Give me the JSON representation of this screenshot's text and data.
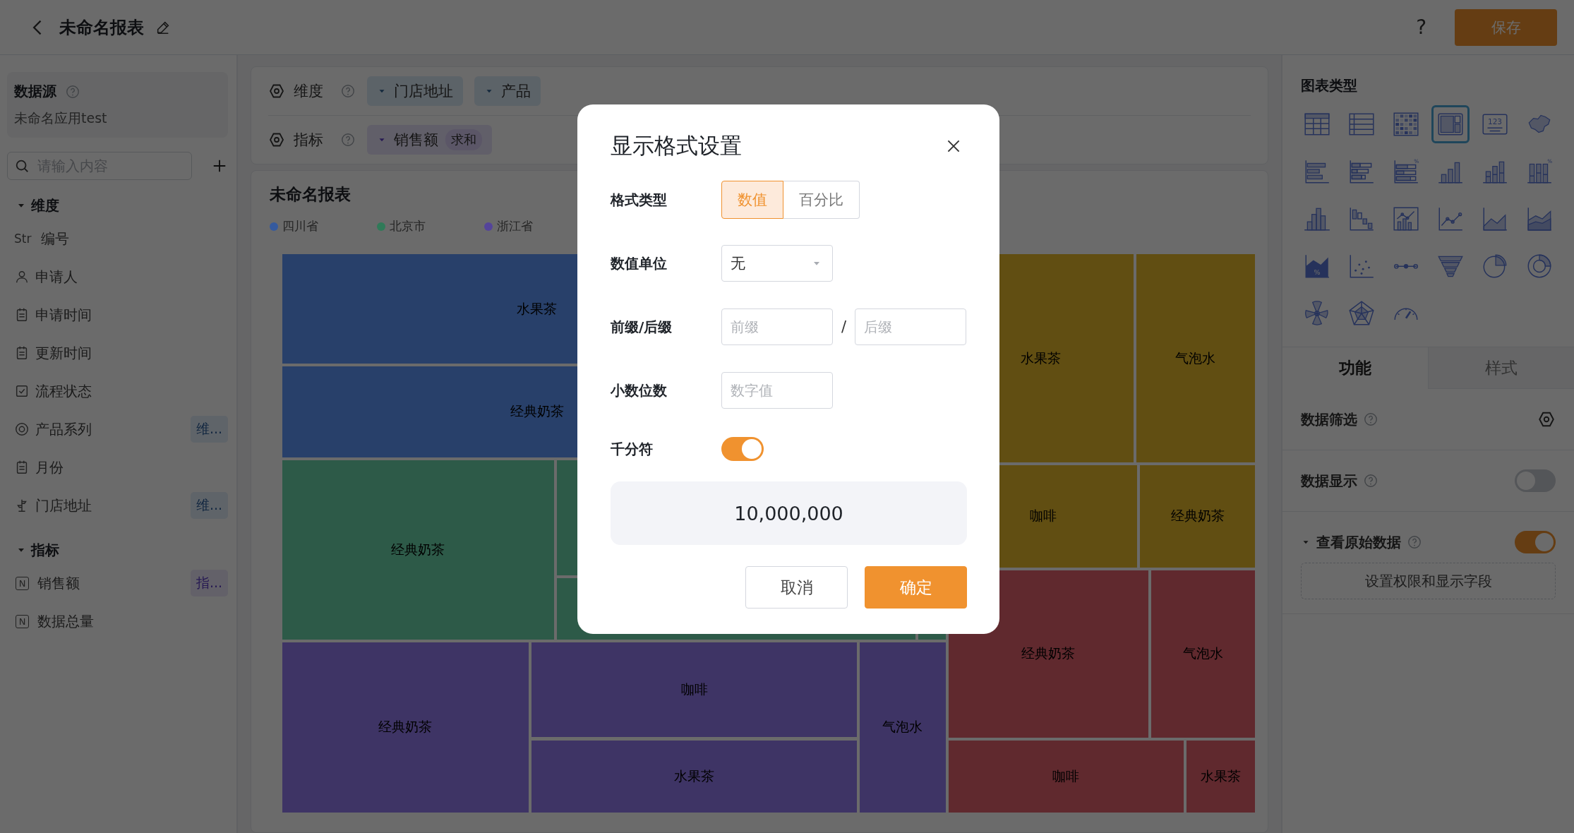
{
  "header": {
    "title": "未命名报表",
    "help": "?",
    "save_button": "保存"
  },
  "sidebar": {
    "datasource": {
      "label": "数据源",
      "value": "未命名应用test"
    },
    "search": {
      "placeholder": "请输入内容"
    },
    "groups": [
      {
        "label": "维度",
        "kind": "dimension",
        "expanded": true,
        "children": [
          {
            "kind": "str",
            "type_label": "Str",
            "label": "编号"
          },
          {
            "kind": "user",
            "label": "申请人"
          },
          {
            "kind": "date",
            "label": "申请时间"
          },
          {
            "kind": "date",
            "label": "更新时间"
          },
          {
            "kind": "check",
            "label": "流程状态"
          },
          {
            "kind": "target",
            "label": "产品系列",
            "badge": "维..."
          },
          {
            "kind": "date",
            "label": "月份"
          },
          {
            "kind": "geo",
            "label": "门店地址",
            "badge": "维..."
          }
        ]
      },
      {
        "label": "指标",
        "kind": "measure",
        "expanded": true,
        "children": [
          {
            "kind": "number",
            "type_label": "N",
            "label": "销售额",
            "badge": "指..."
          },
          {
            "kind": "number",
            "type_label": "N",
            "label": "数据总量"
          }
        ]
      }
    ]
  },
  "config": {
    "rows": [
      {
        "label": "维度",
        "kind": "dimension",
        "fields": [
          {
            "label": "门店地址"
          },
          {
            "label": "产品"
          }
        ]
      },
      {
        "label": "指标",
        "kind": "measure",
        "fields": [
          {
            "label": "销售额",
            "aggregate": "求和"
          }
        ]
      }
    ]
  },
  "chart": {
    "title": "未命名报表",
    "legend": [
      {
        "label": "四川省",
        "color": "#355a9e"
      },
      {
        "label": "北京市",
        "color": "#2f7a58"
      },
      {
        "label": "浙江省",
        "color": "#54449a"
      }
    ],
    "treemap": {
      "groups": [
        {
          "color": "#28406a",
          "cells": [
            {
              "label": "水果茶"
            },
            {
              "label": "经典奶茶"
            },
            {},
            {}
          ]
        },
        {
          "color": "#2d5a48",
          "cells": [
            {
              "label": "经典奶茶"
            },
            {},
            {},
            {}
          ]
        },
        {
          "color": "#3e3465",
          "cells": [
            {
              "label": "经典奶茶"
            },
            {
              "label": "咖啡"
            },
            {
              "label": "水果茶"
            },
            {
              "label": "气泡水"
            }
          ]
        },
        {
          "color": "#614e12",
          "cells": [
            {
              "label": "水果茶"
            },
            {
              "label": "气泡水"
            },
            {
              "label": "咖啡"
            },
            {
              "label": "经典奶茶"
            }
          ]
        },
        {
          "color": "#60292e",
          "cells": [
            {
              "label": "经典奶茶"
            },
            {
              "label": "气泡水"
            },
            {
              "label": "咖啡"
            },
            {
              "label": "水果茶"
            }
          ]
        }
      ]
    }
  },
  "right_panel": {
    "chart_types": {
      "title": "图表类型",
      "items": [
        {
          "kind": "table",
          "selected": false
        },
        {
          "kind": "list",
          "selected": false
        },
        {
          "kind": "heatmap",
          "selected": false
        },
        {
          "kind": "treemap",
          "selected": true
        },
        {
          "kind": "number",
          "selected": false,
          "label": "123"
        },
        {
          "kind": "map",
          "selected": false
        },
        {
          "kind": "hbar",
          "selected": false
        },
        {
          "kind": "stacked-hbar",
          "selected": false
        },
        {
          "kind": "pct-hbar",
          "selected": false,
          "label": "%"
        },
        {
          "kind": "vbar",
          "selected": false
        },
        {
          "kind": "stacked-vbar",
          "selected": false
        },
        {
          "kind": "pct-vbar",
          "selected": false,
          "label": "%"
        },
        {
          "kind": "histogram",
          "selected": false
        },
        {
          "kind": "waterfall",
          "selected": false
        },
        {
          "kind": "combo",
          "selected": false
        },
        {
          "kind": "line",
          "selected": false
        },
        {
          "kind": "area",
          "selected": false
        },
        {
          "kind": "stacked-area",
          "selected": false
        },
        {
          "kind": "pct-area",
          "selected": false,
          "label": "%"
        },
        {
          "kind": "scatter",
          "selected": false
        },
        {
          "kind": "dumbbell",
          "selected": false
        },
        {
          "kind": "funnel",
          "selected": false
        },
        {
          "kind": "pie",
          "selected": false
        },
        {
          "kind": "donut",
          "selected": false
        },
        {
          "kind": "rose",
          "selected": false
        },
        {
          "kind": "radar",
          "selected": false
        },
        {
          "kind": "gauge",
          "selected": false
        }
      ]
    },
    "tabs": [
      {
        "label": "功能",
        "selected": true
      },
      {
        "label": "样式",
        "selected": false
      }
    ],
    "settings": [
      {
        "kind": "filter",
        "label": "数据筛选"
      },
      {
        "kind": "toggle",
        "label": "数据显示",
        "on": false
      },
      {
        "kind": "section",
        "label": "查看原始数据",
        "expanded": true,
        "on": true,
        "button": "设置权限和显示字段"
      }
    ]
  },
  "modal": {
    "title": "显示格式设置",
    "rows": [
      {
        "kind": "segmented",
        "label": "格式类型",
        "options": [
          {
            "label": "数值",
            "selected": true
          },
          {
            "label": "百分比",
            "selected": false
          }
        ]
      },
      {
        "kind": "select",
        "label": "数值单位",
        "value": "无"
      },
      {
        "kind": "affix",
        "label": "前缀/后缀",
        "separator": "/",
        "fields": [
          {
            "placeholder": "前缀"
          },
          {
            "placeholder": "后缀"
          }
        ]
      },
      {
        "kind": "input",
        "label": "小数位数",
        "placeholder": "数字值"
      },
      {
        "kind": "toggle",
        "label": "千分符",
        "on": true
      }
    ],
    "preview": "10,000,000",
    "buttons": [
      {
        "kind": "secondary",
        "label": "取消"
      },
      {
        "kind": "primary",
        "label": "确定"
      }
    ]
  }
}
